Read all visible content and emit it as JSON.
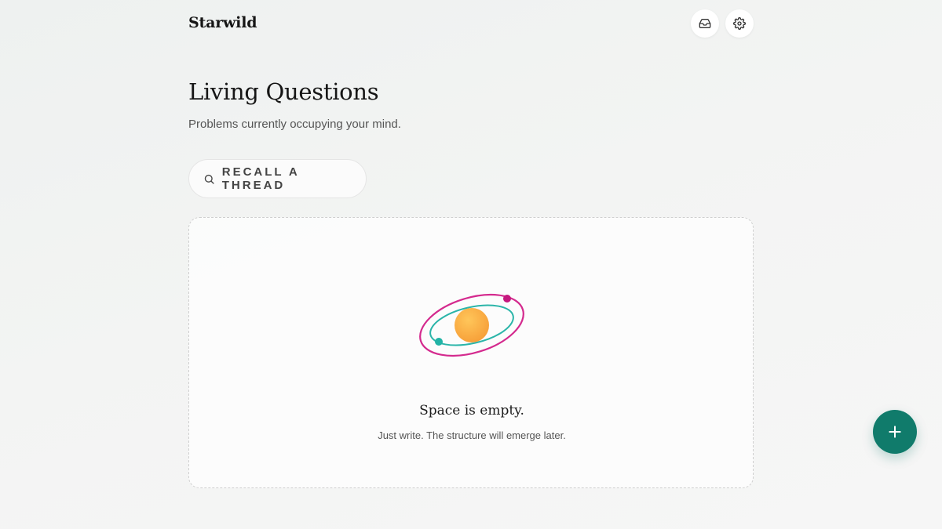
{
  "app": {
    "brand": "Starwild"
  },
  "header": {
    "icons": [
      "inbox-icon",
      "gear-icon"
    ]
  },
  "main": {
    "title": "Living Questions",
    "subtitle": "Problems currently occupying your mind.",
    "recall_button": {
      "label": "RECALL A THREAD",
      "icon": "search-icon"
    }
  },
  "empty_state": {
    "illustration": "orbit-icon",
    "title": "Space is empty.",
    "hint": "Just write. The structure will emerge later."
  },
  "fab": {
    "icon": "plus-icon"
  },
  "colors": {
    "accent": "#107b6b",
    "orbit_outer": "#d42a8e",
    "orbit_inner": "#2bb5a9",
    "sun": "#fbb03b"
  }
}
